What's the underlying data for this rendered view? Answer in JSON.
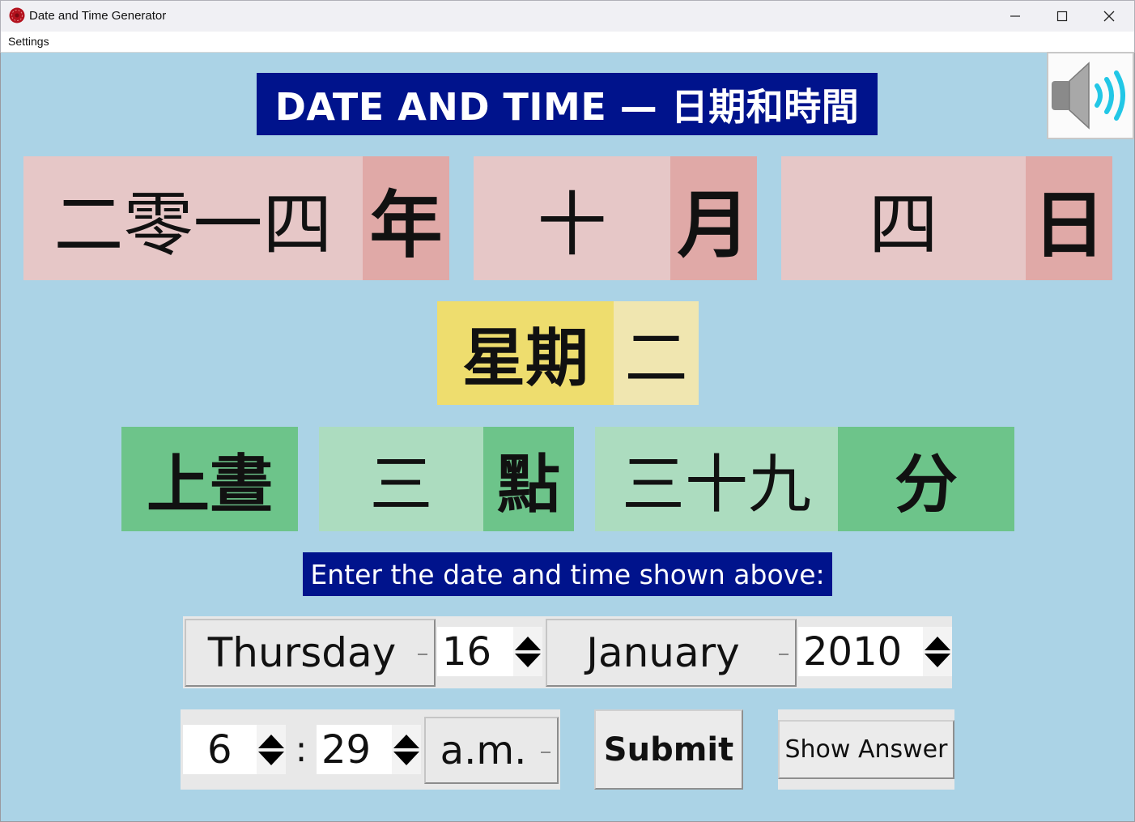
{
  "window": {
    "title": "Date and Time Generator",
    "menu": [
      "Settings"
    ]
  },
  "colors": {
    "background": "#abd3e6",
    "banner": "#00138c",
    "date_light": "#e6c7c7",
    "date_dark": "#e0a9a7",
    "weekday_dark": "#eedd6e",
    "weekday_light": "#f0e6b0",
    "time_dark": "#6dc48a",
    "time_light": "#acdcbf"
  },
  "banner": {
    "text": "DATE AND TIME — 日期和時間"
  },
  "speaker": {
    "icon": "speaker-volume-icon"
  },
  "date_row": {
    "year_value": "二零一四",
    "year_unit": "年",
    "month_value": "十",
    "month_unit": "月",
    "day_value": "四",
    "day_unit": "日"
  },
  "weekday_row": {
    "label": "星期",
    "value": "二"
  },
  "time_row": {
    "period": "上晝",
    "hour_value": "三",
    "hour_unit": "點",
    "minute_value": "三十九",
    "minute_unit": "分"
  },
  "prompt": {
    "text": "Enter the date and time shown above:"
  },
  "form": {
    "weekday": "Thursday",
    "day": "16",
    "month": "January",
    "year": "2010",
    "hour": "6",
    "separator": ":",
    "minute": "29",
    "ampm": "a.m.",
    "submit_label": "Submit",
    "show_answer_label": "Show Answer"
  }
}
